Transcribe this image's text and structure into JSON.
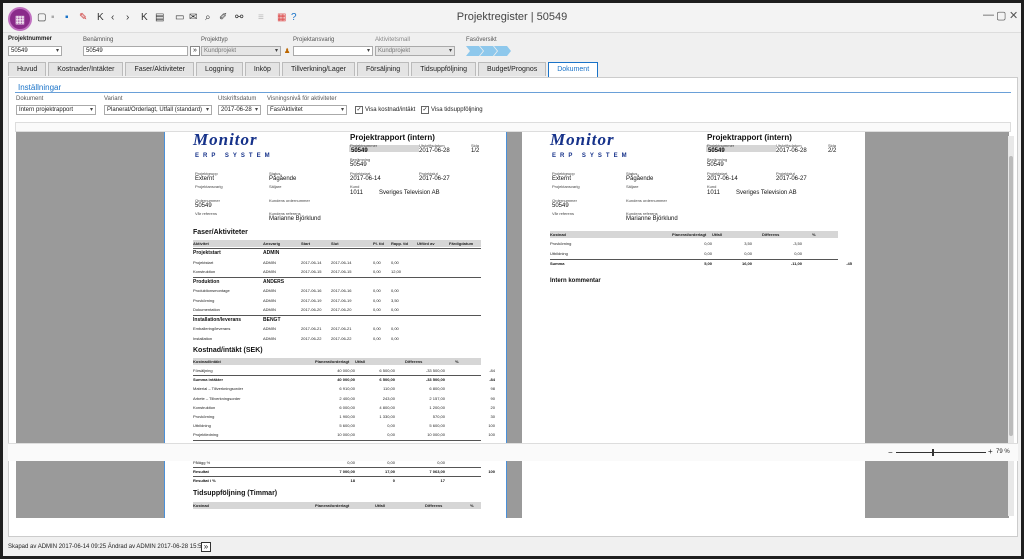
{
  "window": {
    "title": "Projektregister | 50549",
    "min": "—",
    "max": "▢",
    "close": "✕"
  },
  "form": {
    "projektnummer_label": "Projektnummer",
    "projektnummer": "50549",
    "benamning_label": "Benämning",
    "benamning": "50549",
    "projekttyp_label": "Projekttyp",
    "projekttyp": "Kundprojekt",
    "projektansvarig_label": "Projektansvarig",
    "projektansvarig": "",
    "aktivitetsmall_label": "Aktivitetsmall",
    "aktivitetsmall": "Kundprojekt",
    "fasoversikt_label": "Fasöversikt"
  },
  "tabs": [
    "Huvud",
    "Kostnader/Intäkter",
    "Faser/Aktiviteter",
    "Loggning",
    "Inköp",
    "Tillverkning/Lager",
    "Försäljning",
    "Tidsuppföljning",
    "Budget/Prognos",
    "Dokument"
  ],
  "settings": {
    "title": "Inställningar",
    "dokument_label": "Dokument",
    "dokument": "Intern projektrapport",
    "variant_label": "Variant",
    "variant": "Planerat/Orderlagt, Utfall (standard)",
    "utskrift_label": "Utskriftsdatum",
    "utskrift": "2017-06-28",
    "visning_label": "Visningsnivå för aktiviteter",
    "visning": "Fas/Aktivitet",
    "chk1": "Visa kostnad/intäkt",
    "chk2": "Visa tidsuppföljning",
    "check": "✓"
  },
  "report": {
    "logo": "Monitor",
    "logo_sub": "ERP SYSTEM",
    "title": "Projektrapport (intern)",
    "l_projnr": "Projektnummer",
    "projnr": "50549",
    "l_utskrift": "Utskriftsdatum",
    "utskrift": "2017-06-28",
    "l_sida": "Sida",
    "sida1": "1/2",
    "sida2": "2/2",
    "l_benamning": "Benämning",
    "benamning": "50549",
    "l_projgrupp": "Projektgrupp",
    "projgrupp": "Externt",
    "l_status": "Status",
    "status": "Pågående",
    "l_projstart": "Projektstart",
    "projstart": "2017-06-14",
    "l_projslut": "Projektslut",
    "projslut": "2017-06-27",
    "l_ansvarig": "Projektansvarig",
    "l_saljare": "Säljare",
    "l_kund": "Kund",
    "kundnr": "1011",
    "kund": "Sveriges Television AB",
    "l_ordernr": "Ordernummer",
    "ordernr": "50549",
    "l_kundorder": "Kundens ordernummer",
    "l_varref": "Vår referens",
    "l_kundref": "Kundens referens",
    "kundref": "Marianne Björklund",
    "fas_title": "Faser/Aktiviteter",
    "fas_cols": [
      "Aktivitet",
      "Ansvarig",
      "Start",
      "Slut",
      "Pl. tid",
      "Rapp. tid",
      "Utförd av",
      "Färdigdatum"
    ],
    "fas_rows": [
      {
        "g": 1,
        "c": [
          "Projektstart",
          "ADMIN"
        ]
      },
      {
        "g": 0,
        "c": [
          "Projektstart",
          "ADMIN",
          "2017-06-14",
          "2017-06-14",
          "0,00",
          "0,00"
        ]
      },
      {
        "g": 0,
        "c": [
          "Konstruktion",
          "ADMIN",
          "2017-06-15",
          "2017-06-15",
          "0,00",
          "12,00"
        ]
      },
      {
        "g": 1,
        "c": [
          "Produktion",
          "ANDERS"
        ]
      },
      {
        "g": 0,
        "c": [
          "Produktionsmontage",
          "ADMIN",
          "2017-06-16",
          "2017-06-16",
          "0,00",
          "0,00"
        ]
      },
      {
        "g": 0,
        "c": [
          "Provkörning",
          "ADMIN",
          "2017-06-19",
          "2017-06-19",
          "0,00",
          "3,50"
        ]
      },
      {
        "g": 0,
        "c": [
          "Dokumentation",
          "ADMIN",
          "2017-06-20",
          "2017-06-20",
          "0,00",
          "0,00"
        ]
      },
      {
        "g": 1,
        "c": [
          "Installation/leverans",
          "BENGT"
        ]
      },
      {
        "g": 0,
        "c": [
          "Emballering/leverans",
          "ADMIN",
          "2017-06-21",
          "2017-06-21",
          "0,00",
          "0,00"
        ]
      },
      {
        "g": 0,
        "c": [
          "Installation",
          "ADMIN",
          "2017-06-22",
          "2017-06-22",
          "0,00",
          "0,00"
        ]
      }
    ],
    "kost_title": "Kostnad/intäkt (SEK)",
    "kost_cols": [
      "Kostnad/intäkt",
      "Planerat/orderlagt",
      "Utfall",
      "Differens",
      "%"
    ],
    "kost_rows": [
      {
        "b": 0,
        "c": [
          "Försäljning",
          "40 000,00",
          "6 500,00",
          "-33 500,00",
          "-84"
        ]
      },
      {
        "b": 1,
        "c": [
          "Summa intäkter",
          "40 000,00",
          "6 500,00",
          "-33 500,00",
          "-84"
        ]
      },
      {
        "b": 0,
        "c": [
          "Material – Tillverkningsorder",
          "6 910,00",
          "110,00",
          "6 800,00",
          "98"
        ]
      },
      {
        "b": 0,
        "c": [
          "Arbete – Tillverkningsorder",
          "2 400,00",
          "243,00",
          "2 157,00",
          "90"
        ]
      },
      {
        "b": 0,
        "c": [
          "Konstruktion",
          "6 000,00",
          "4 800,00",
          "1 200,00",
          "20"
        ]
      },
      {
        "b": 0,
        "c": [
          "Provkörning",
          "1 900,00",
          "1 330,00",
          "570,00",
          "30"
        ]
      },
      {
        "b": 0,
        "c": [
          "Utbildning",
          "5 600,00",
          "0,00",
          "5 600,00",
          "100"
        ]
      },
      {
        "b": 0,
        "c": [
          "Projektledning",
          "10 000,00",
          "0,00",
          "10 000,00",
          "100"
        ]
      },
      {
        "b": 1,
        "c": [
          "Summa kostnader",
          "32 810,00",
          "6 483,00",
          "26 437,00",
          "81"
        ]
      },
      {
        "b": 1,
        "c": [
          "Resultat före pålägg",
          "7 000,00",
          "17,00",
          "7 063,00",
          "100"
        ]
      },
      {
        "b": 0,
        "c": [
          "Pålägg        %",
          "0,00",
          "0,00",
          "0,00",
          ""
        ]
      },
      {
        "b": 1,
        "c": [
          "Resultat",
          "7 000,00",
          "17,00",
          "7 063,00",
          "100"
        ]
      },
      {
        "b": 1,
        "c": [
          "Resultat i %",
          "18",
          "0",
          "17",
          ""
        ]
      }
    ],
    "tid_title": "Tidsuppföljning (Timmar)",
    "tid_cols": [
      "Kostnad",
      "Planerat/orderlagt",
      "Utfall",
      "Differens",
      "%"
    ],
    "tid_rows": [
      {
        "b": 0,
        "c": [
          "Provkörning",
          "0,00",
          "3,50",
          "-3,50",
          ""
        ]
      },
      {
        "b": 0,
        "c": [
          "Utbildning",
          "0,00",
          "0,00",
          "0,00",
          ""
        ]
      },
      {
        "b": 1,
        "c": [
          "Summa",
          "5,00",
          "16,00",
          "-11,00",
          "-45"
        ]
      }
    ],
    "intern": "Intern kommentar"
  },
  "zoom": "79 %",
  "zoom_level": 0.79,
  "status_text": "Skapad av ADMIN 2017-06-14 09:25   Ändrad av ADMIN 2017-06-28 15:59"
}
